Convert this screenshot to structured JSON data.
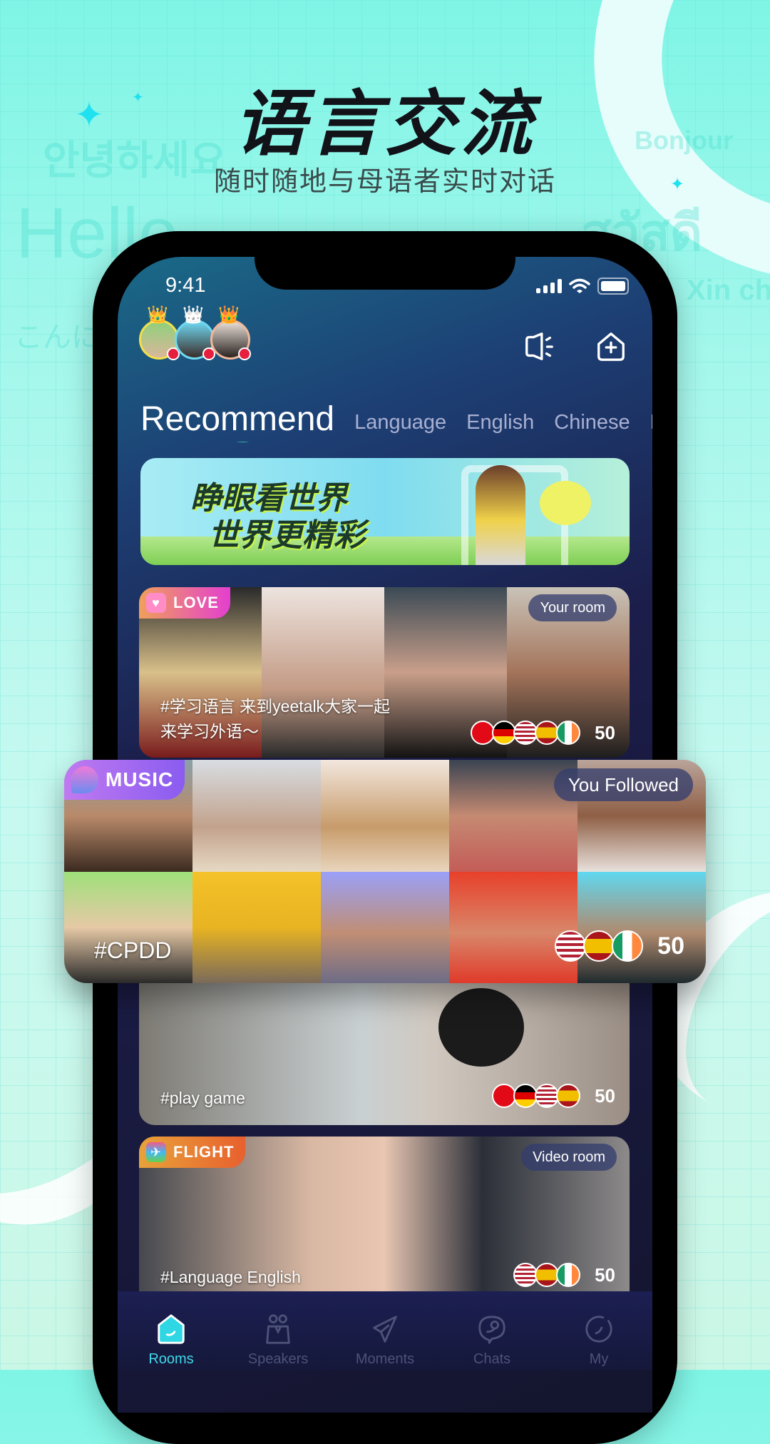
{
  "hero": {
    "title": "语言交流",
    "subtitle": "随时随地与母语者实时对话",
    "background_words": [
      "안녕하세요",
      "Hello",
      "こんにちは",
      "Bonjour",
      "สวัสดี",
      "Xin chào"
    ]
  },
  "status_bar": {
    "time": "9:41"
  },
  "header": {
    "top_users": [
      {
        "crown": "gold",
        "ring": "#f2e04a"
      },
      {
        "crown": "silver",
        "ring": "#6fd9f2"
      },
      {
        "crown": "bronze",
        "ring": "#f2b79a"
      }
    ],
    "icons": [
      "broadcast-icon",
      "add-room-icon"
    ]
  },
  "tabs": [
    {
      "label": "Recommend",
      "active": true
    },
    {
      "label": "Language",
      "active": false
    },
    {
      "label": "English",
      "active": false
    },
    {
      "label": "Chinese",
      "active": false
    },
    {
      "label": "M",
      "active": false
    }
  ],
  "banner": {
    "line1": "睁眼看世界",
    "line2": "世界更精彩"
  },
  "rooms": [
    {
      "category": "LOVE",
      "tag_pill": "Your room",
      "caption_line1": "#学习语言 来到yeetalk大家一起",
      "caption_line2": "来学习外语～",
      "flags": [
        "Turkey",
        "Germany",
        "USA",
        "Spain",
        "Ireland"
      ],
      "count": "50"
    },
    {
      "category": "MUSIC",
      "tag_pill": "You Followed",
      "caption_line1": "#CPDD",
      "caption_line2": "",
      "flags": [
        "USA",
        "Spain",
        "Ireland"
      ],
      "count": "50"
    },
    {
      "category": "",
      "tag_pill": "",
      "caption_line1": "#play game",
      "caption_line2": "",
      "flags": [
        "Turkey",
        "Germany",
        "USA",
        "Spain"
      ],
      "count": "50"
    },
    {
      "category": "FLIGHT",
      "tag_pill": "Video room",
      "caption_line1": "#Language English",
      "caption_line2": "",
      "flags": [
        "USA",
        "Spain",
        "Ireland"
      ],
      "count": "50"
    }
  ],
  "tabbar": [
    {
      "label": "Rooms",
      "active": true
    },
    {
      "label": "Speakers",
      "active": false
    },
    {
      "label": "Moments",
      "active": false
    },
    {
      "label": "Chats",
      "active": false
    },
    {
      "label": "My",
      "active": false
    }
  ],
  "colors": {
    "accent": "#3fd9e8",
    "love": "#e43fd0",
    "music": "#8a5cf0",
    "flight": "#e8602e"
  }
}
